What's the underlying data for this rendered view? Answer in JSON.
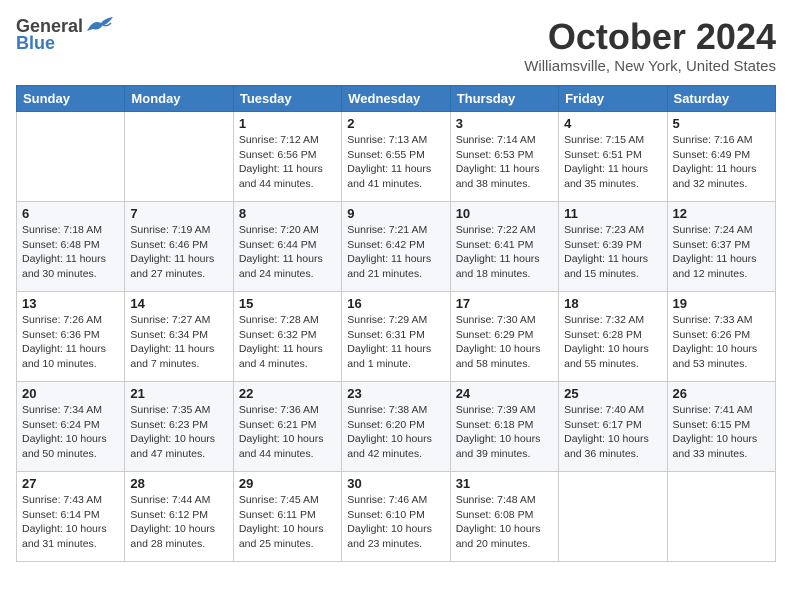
{
  "header": {
    "logo_general": "General",
    "logo_blue": "Blue",
    "month_title": "October 2024",
    "location": "Williamsville, New York, United States"
  },
  "days_of_week": [
    "Sunday",
    "Monday",
    "Tuesday",
    "Wednesday",
    "Thursday",
    "Friday",
    "Saturday"
  ],
  "weeks": [
    [
      {
        "day": "",
        "sunrise": "",
        "sunset": "",
        "daylight": ""
      },
      {
        "day": "",
        "sunrise": "",
        "sunset": "",
        "daylight": ""
      },
      {
        "day": "1",
        "sunrise": "Sunrise: 7:12 AM",
        "sunset": "Sunset: 6:56 PM",
        "daylight": "Daylight: 11 hours and 44 minutes."
      },
      {
        "day": "2",
        "sunrise": "Sunrise: 7:13 AM",
        "sunset": "Sunset: 6:55 PM",
        "daylight": "Daylight: 11 hours and 41 minutes."
      },
      {
        "day": "3",
        "sunrise": "Sunrise: 7:14 AM",
        "sunset": "Sunset: 6:53 PM",
        "daylight": "Daylight: 11 hours and 38 minutes."
      },
      {
        "day": "4",
        "sunrise": "Sunrise: 7:15 AM",
        "sunset": "Sunset: 6:51 PM",
        "daylight": "Daylight: 11 hours and 35 minutes."
      },
      {
        "day": "5",
        "sunrise": "Sunrise: 7:16 AM",
        "sunset": "Sunset: 6:49 PM",
        "daylight": "Daylight: 11 hours and 32 minutes."
      }
    ],
    [
      {
        "day": "6",
        "sunrise": "Sunrise: 7:18 AM",
        "sunset": "Sunset: 6:48 PM",
        "daylight": "Daylight: 11 hours and 30 minutes."
      },
      {
        "day": "7",
        "sunrise": "Sunrise: 7:19 AM",
        "sunset": "Sunset: 6:46 PM",
        "daylight": "Daylight: 11 hours and 27 minutes."
      },
      {
        "day": "8",
        "sunrise": "Sunrise: 7:20 AM",
        "sunset": "Sunset: 6:44 PM",
        "daylight": "Daylight: 11 hours and 24 minutes."
      },
      {
        "day": "9",
        "sunrise": "Sunrise: 7:21 AM",
        "sunset": "Sunset: 6:42 PM",
        "daylight": "Daylight: 11 hours and 21 minutes."
      },
      {
        "day": "10",
        "sunrise": "Sunrise: 7:22 AM",
        "sunset": "Sunset: 6:41 PM",
        "daylight": "Daylight: 11 hours and 18 minutes."
      },
      {
        "day": "11",
        "sunrise": "Sunrise: 7:23 AM",
        "sunset": "Sunset: 6:39 PM",
        "daylight": "Daylight: 11 hours and 15 minutes."
      },
      {
        "day": "12",
        "sunrise": "Sunrise: 7:24 AM",
        "sunset": "Sunset: 6:37 PM",
        "daylight": "Daylight: 11 hours and 12 minutes."
      }
    ],
    [
      {
        "day": "13",
        "sunrise": "Sunrise: 7:26 AM",
        "sunset": "Sunset: 6:36 PM",
        "daylight": "Daylight: 11 hours and 10 minutes."
      },
      {
        "day": "14",
        "sunrise": "Sunrise: 7:27 AM",
        "sunset": "Sunset: 6:34 PM",
        "daylight": "Daylight: 11 hours and 7 minutes."
      },
      {
        "day": "15",
        "sunrise": "Sunrise: 7:28 AM",
        "sunset": "Sunset: 6:32 PM",
        "daylight": "Daylight: 11 hours and 4 minutes."
      },
      {
        "day": "16",
        "sunrise": "Sunrise: 7:29 AM",
        "sunset": "Sunset: 6:31 PM",
        "daylight": "Daylight: 11 hours and 1 minute."
      },
      {
        "day": "17",
        "sunrise": "Sunrise: 7:30 AM",
        "sunset": "Sunset: 6:29 PM",
        "daylight": "Daylight: 10 hours and 58 minutes."
      },
      {
        "day": "18",
        "sunrise": "Sunrise: 7:32 AM",
        "sunset": "Sunset: 6:28 PM",
        "daylight": "Daylight: 10 hours and 55 minutes."
      },
      {
        "day": "19",
        "sunrise": "Sunrise: 7:33 AM",
        "sunset": "Sunset: 6:26 PM",
        "daylight": "Daylight: 10 hours and 53 minutes."
      }
    ],
    [
      {
        "day": "20",
        "sunrise": "Sunrise: 7:34 AM",
        "sunset": "Sunset: 6:24 PM",
        "daylight": "Daylight: 10 hours and 50 minutes."
      },
      {
        "day": "21",
        "sunrise": "Sunrise: 7:35 AM",
        "sunset": "Sunset: 6:23 PM",
        "daylight": "Daylight: 10 hours and 47 minutes."
      },
      {
        "day": "22",
        "sunrise": "Sunrise: 7:36 AM",
        "sunset": "Sunset: 6:21 PM",
        "daylight": "Daylight: 10 hours and 44 minutes."
      },
      {
        "day": "23",
        "sunrise": "Sunrise: 7:38 AM",
        "sunset": "Sunset: 6:20 PM",
        "daylight": "Daylight: 10 hours and 42 minutes."
      },
      {
        "day": "24",
        "sunrise": "Sunrise: 7:39 AM",
        "sunset": "Sunset: 6:18 PM",
        "daylight": "Daylight: 10 hours and 39 minutes."
      },
      {
        "day": "25",
        "sunrise": "Sunrise: 7:40 AM",
        "sunset": "Sunset: 6:17 PM",
        "daylight": "Daylight: 10 hours and 36 minutes."
      },
      {
        "day": "26",
        "sunrise": "Sunrise: 7:41 AM",
        "sunset": "Sunset: 6:15 PM",
        "daylight": "Daylight: 10 hours and 33 minutes."
      }
    ],
    [
      {
        "day": "27",
        "sunrise": "Sunrise: 7:43 AM",
        "sunset": "Sunset: 6:14 PM",
        "daylight": "Daylight: 10 hours and 31 minutes."
      },
      {
        "day": "28",
        "sunrise": "Sunrise: 7:44 AM",
        "sunset": "Sunset: 6:12 PM",
        "daylight": "Daylight: 10 hours and 28 minutes."
      },
      {
        "day": "29",
        "sunrise": "Sunrise: 7:45 AM",
        "sunset": "Sunset: 6:11 PM",
        "daylight": "Daylight: 10 hours and 25 minutes."
      },
      {
        "day": "30",
        "sunrise": "Sunrise: 7:46 AM",
        "sunset": "Sunset: 6:10 PM",
        "daylight": "Daylight: 10 hours and 23 minutes."
      },
      {
        "day": "31",
        "sunrise": "Sunrise: 7:48 AM",
        "sunset": "Sunset: 6:08 PM",
        "daylight": "Daylight: 10 hours and 20 minutes."
      },
      {
        "day": "",
        "sunrise": "",
        "sunset": "",
        "daylight": ""
      },
      {
        "day": "",
        "sunrise": "",
        "sunset": "",
        "daylight": ""
      }
    ]
  ]
}
